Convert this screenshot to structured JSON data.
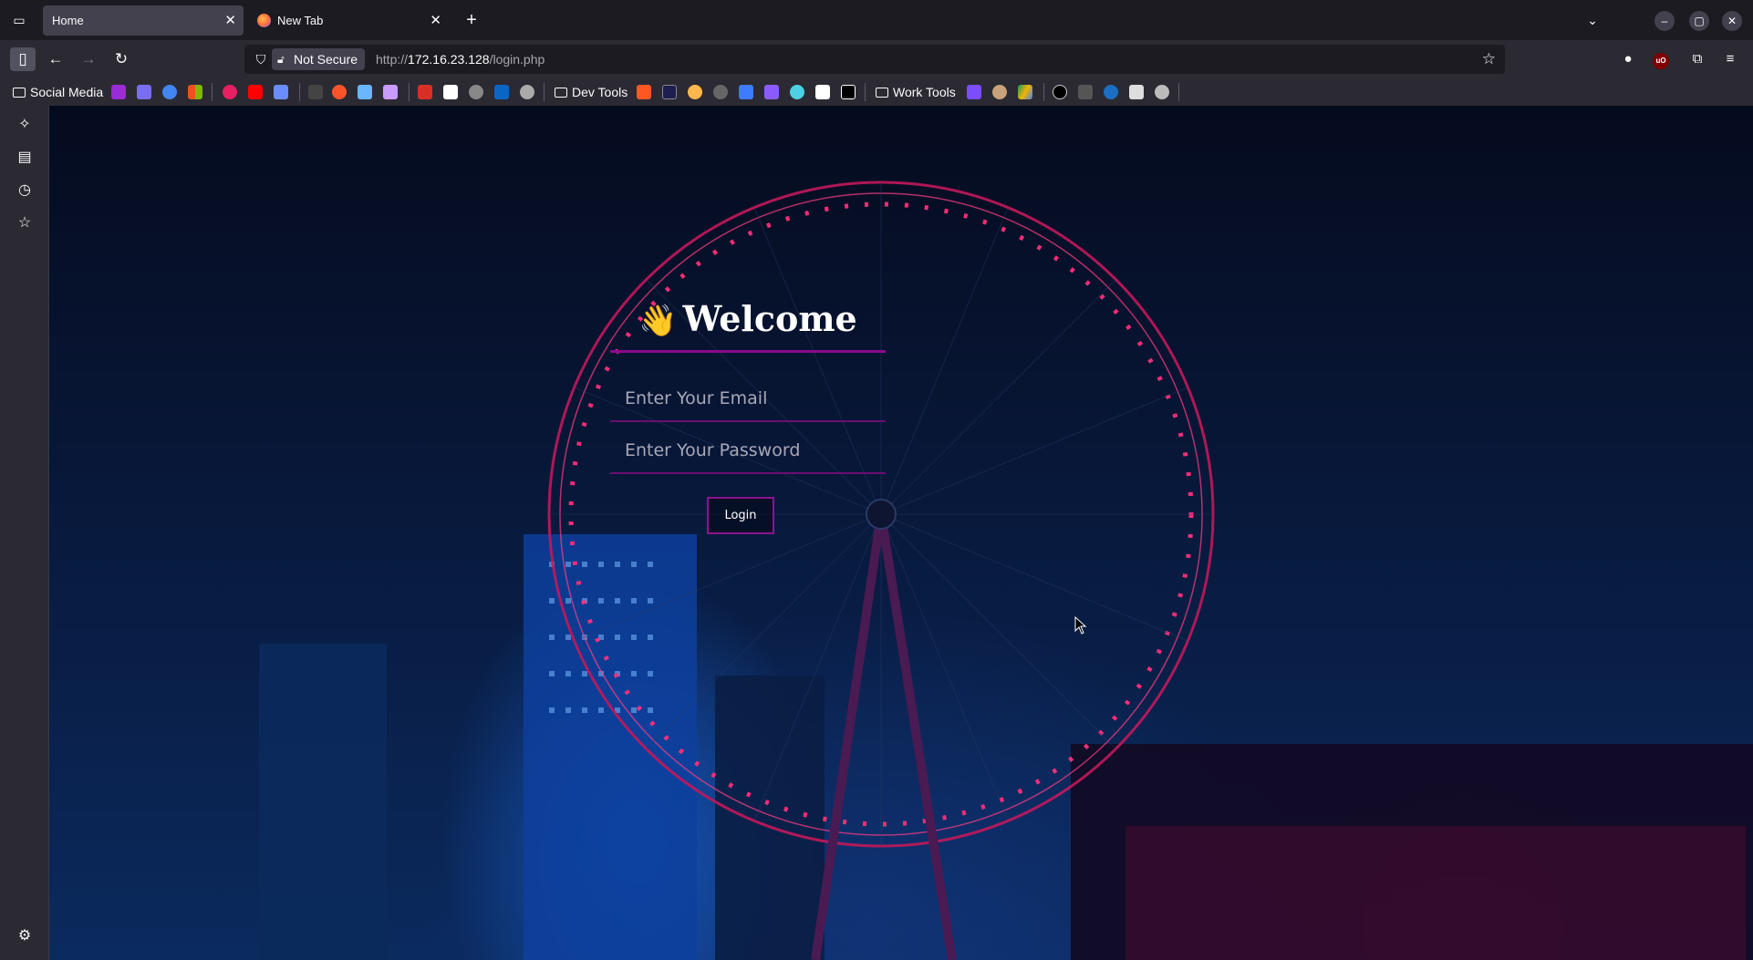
{
  "tabs": [
    {
      "label": "Home",
      "active": true
    },
    {
      "label": "New Tab",
      "active": false
    }
  ],
  "urlbar": {
    "security_label": "Not Secure",
    "url_prefix": "http://",
    "url_host": "172.16.23.128",
    "url_path": "/login.php"
  },
  "bookmarks": {
    "folders": [
      "Social Media",
      "Dev Tools",
      "Work Tools"
    ]
  },
  "login": {
    "heading_emoji": "👋",
    "heading": "Welcome",
    "email_placeholder": "Enter Your Email",
    "password_placeholder": "Enter Your Password",
    "login_label": "Login"
  },
  "colors": {
    "accent": "#8a0a8e",
    "wheel_lights": "#ff2e7a",
    "browser_chrome": "#2b2a33"
  }
}
